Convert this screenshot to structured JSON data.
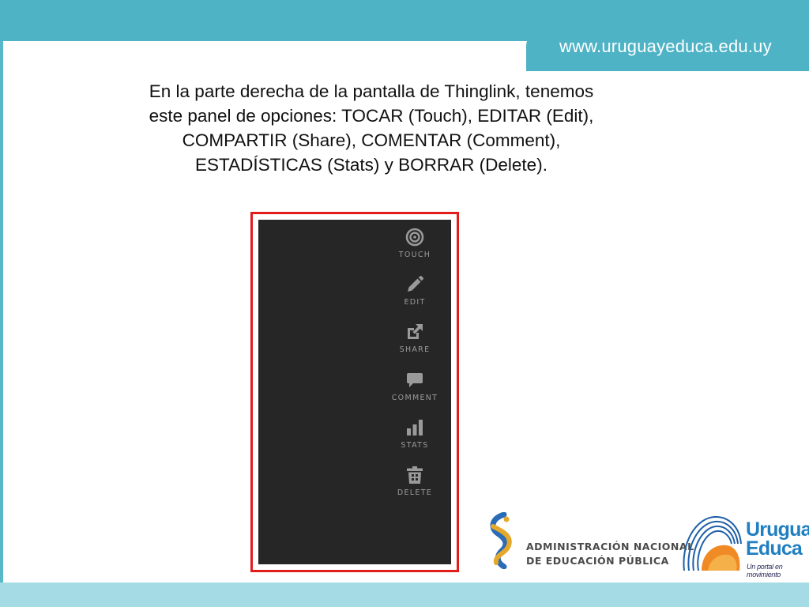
{
  "header": {
    "url": "www.uruguayeduca.edu.uy"
  },
  "intro": {
    "lines": [
      "En la parte derecha de la pantalla de Thinglink, tenemos",
      "este panel de opciones:  TOCAR (Touch), EDITAR (Edit),",
      "COMPARTIR (Share), COMENTAR (Comment),",
      "ESTADÍSTICAS (Stats) y BORRAR (Delete)."
    ]
  },
  "panel": {
    "options": [
      {
        "label": "TOUCH",
        "icon": "target-icon"
      },
      {
        "label": "EDIT",
        "icon": "pencil-icon"
      },
      {
        "label": "SHARE",
        "icon": "share-icon"
      },
      {
        "label": "COMMENT",
        "icon": "comment-icon"
      },
      {
        "label": "STATS",
        "icon": "bar-chart-icon"
      },
      {
        "label": "DELETE",
        "icon": "trash-icon"
      }
    ],
    "icon_color": "#9a9a9a",
    "background": "#262626",
    "highlight_color": "#e21b1b"
  },
  "footer": {
    "anep_lines": [
      "ADMINISTRACIÓN NACIONAL",
      "DE EDUCACIÓN PÚBLICA"
    ],
    "ue_lines": [
      "Uruguay",
      "Educa"
    ],
    "ue_tagline": "Un portal en movimiento"
  },
  "colors": {
    "header_band": "#4fb3c6",
    "footer_band": "#a5dbe4"
  }
}
